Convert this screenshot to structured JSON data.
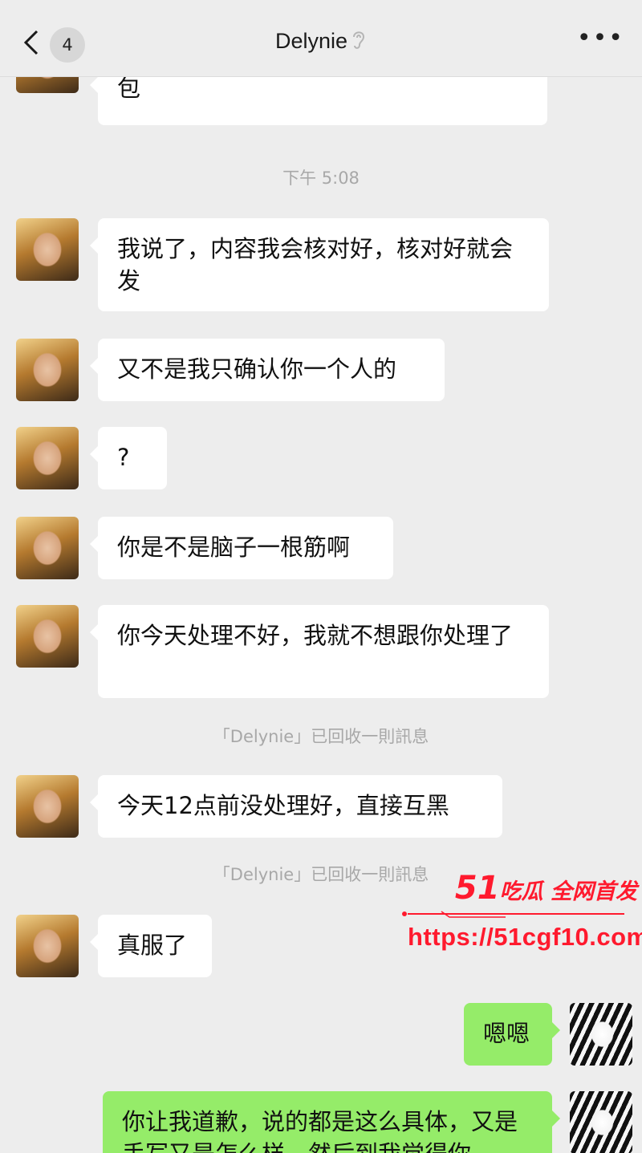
{
  "header": {
    "back_label": "<",
    "unread_count": "4",
    "title": "Delynie",
    "title_icon": "ear-icon",
    "more_label": "•••"
  },
  "messages": [
    {
      "side": "in",
      "text": "包"
    },
    {
      "time": "下午 5:08"
    },
    {
      "side": "in",
      "text": "我说了，内容我会核对好，核对好就会发"
    },
    {
      "side": "in",
      "text": "又不是我只确认你一个人的"
    },
    {
      "side": "in",
      "text": "?"
    },
    {
      "side": "in",
      "text": "你是不是脑子一根筋啊"
    },
    {
      "side": "in",
      "text": "你今天处理不好，我就不想跟你处理了"
    },
    {
      "system": "「Delynie」已回收一則訊息"
    },
    {
      "side": "in",
      "text": "今天12点前没处理好，直接互黑"
    },
    {
      "system": "「Delynie」已回收一則訊息"
    },
    {
      "side": "in",
      "text": "真服了"
    },
    {
      "side": "out",
      "text": "嗯嗯"
    },
    {
      "side": "out",
      "text": "你让我道歉，说的都是这么具体，又是手写又是怎么样，然后到我觉得你"
    }
  ],
  "watermark": {
    "brand_number": "51",
    "brand_text": "吃瓜 全网首发",
    "url": "https://51cgf10.com"
  },
  "colors": {
    "background": "#ededed",
    "incoming_bubble": "#ffffff",
    "outgoing_bubble": "#95ec69",
    "watermark": "#ff1a2e"
  }
}
